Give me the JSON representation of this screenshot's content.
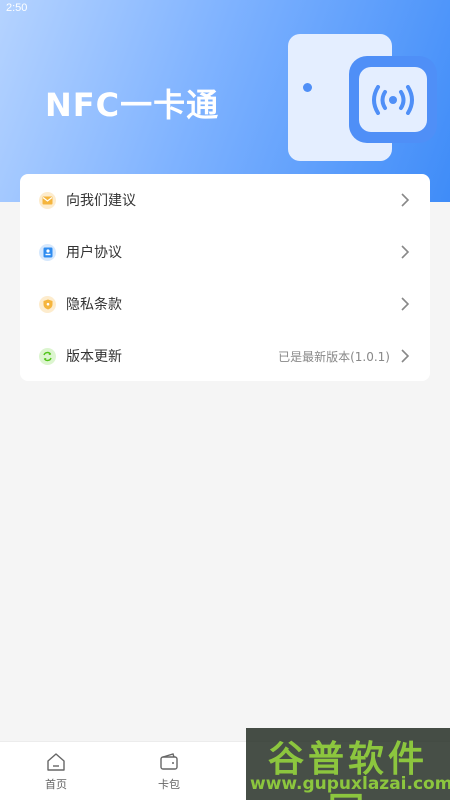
{
  "status_bar": {
    "time": "2:50"
  },
  "header": {
    "title": "NFC一卡通"
  },
  "menu": {
    "items": [
      {
        "label": "向我们建议",
        "icon": "mail-icon",
        "color": "#f5b53d",
        "value": ""
      },
      {
        "label": "用户协议",
        "icon": "user-card-icon",
        "color": "#2f8cf0",
        "value": ""
      },
      {
        "label": "隐私条款",
        "icon": "shield-icon",
        "color": "#f5b53d",
        "value": ""
      },
      {
        "label": "版本更新",
        "icon": "refresh-icon",
        "color": "#52c41a",
        "value": "已是最新版本(1.0.1)"
      }
    ]
  },
  "tabbar": {
    "items": [
      {
        "label": "首页",
        "icon": "home-icon"
      },
      {
        "label": "卡包",
        "icon": "wallet-icon"
      }
    ]
  },
  "watermark": {
    "main": "谷普软件园",
    "url": "www.gupuxlazai.com"
  },
  "colors": {
    "accent": "#4f8ff7",
    "header_light": "#b5d3ff",
    "header_dark": "#3f8cf8"
  }
}
